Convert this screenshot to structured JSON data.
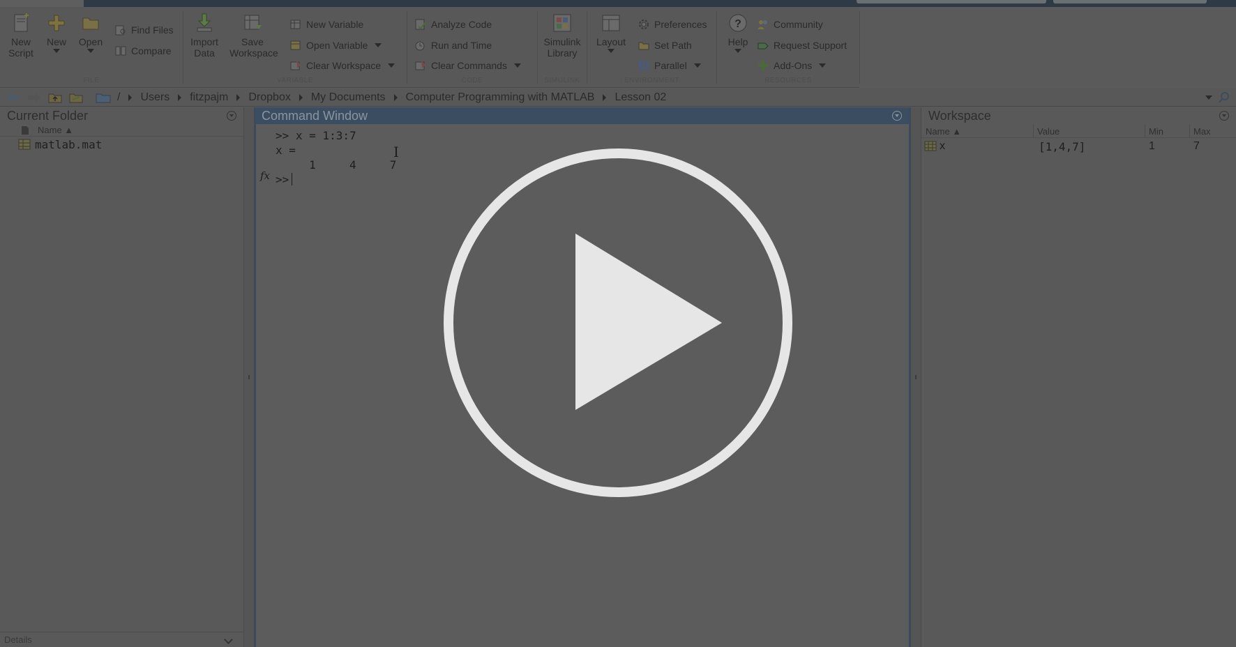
{
  "ribbon": {
    "file": {
      "caption": "FILE",
      "new_script": {
        "line1": "New",
        "line2": "Script"
      },
      "new": "New",
      "open": "Open",
      "find_files": "Find Files",
      "compare": "Compare"
    },
    "variable": {
      "caption": "VARIABLE",
      "import_data": {
        "line1": "Import",
        "line2": "Data"
      },
      "save_workspace": {
        "line1": "Save",
        "line2": "Workspace"
      },
      "new_variable": "New Variable",
      "open_variable": "Open Variable",
      "clear_workspace": "Clear Workspace"
    },
    "code": {
      "caption": "CODE",
      "analyze_code": "Analyze Code",
      "run_and_time": "Run and Time",
      "clear_commands": "Clear Commands"
    },
    "simulink": {
      "caption": "SIMULINK",
      "library": {
        "line1": "Simulink",
        "line2": "Library"
      }
    },
    "environment": {
      "caption": "ENVIRONMENT",
      "layout": "Layout",
      "preferences": "Preferences",
      "set_path": "Set Path",
      "parallel": "Parallel"
    },
    "resources": {
      "caption": "RESOURCES",
      "help": "Help",
      "community": "Community",
      "request_support": "Request Support",
      "add_ons": "Add-Ons"
    }
  },
  "address_bar": {
    "root": "/",
    "path": [
      "Users",
      "fitzpajm",
      "Dropbox",
      "My Documents",
      "Computer Programming with MATLAB",
      "Lesson 02"
    ]
  },
  "current_folder": {
    "title": "Current Folder",
    "column_name": "Name ▲",
    "files": [
      {
        "name": "matlab.mat",
        "icon": "mat-file-icon"
      }
    ],
    "details_label": "Details"
  },
  "command_window": {
    "title": "Command Window",
    "lines": [
      ">> x = 1:3:7",
      "x =",
      "     1     4     7"
    ],
    "prompt": ">>",
    "fx_label": "fx"
  },
  "workspace": {
    "title": "Workspace",
    "columns": {
      "name": "Name ▲",
      "value": "Value",
      "min": "Min",
      "max": "Max"
    },
    "rows": [
      {
        "name": "x",
        "value": "[1,4,7]",
        "min": "1",
        "max": "7"
      }
    ]
  },
  "overlay": {
    "icon": "play-icon",
    "ring_color": "#e6e6e6",
    "dim_color": "#5a5a5a"
  }
}
